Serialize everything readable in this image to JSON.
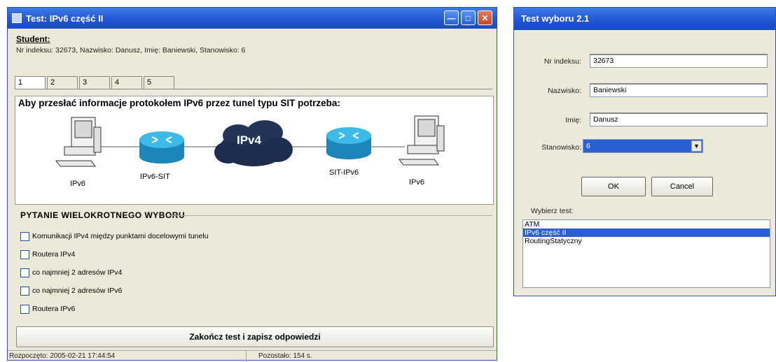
{
  "main_window": {
    "title": "Test: IPv6 część II",
    "student_header": "Student:",
    "student_info": "Nr indeksu: 32673,  Nazwisko: Danusz,  Imię: Baniewski,  Stanowisko: 6",
    "tabs": [
      {
        "label": "1",
        "active": true
      },
      {
        "label": "2",
        "active": false
      },
      {
        "label": "3",
        "active": false
      },
      {
        "label": "4",
        "active": false
      },
      {
        "label": "5",
        "active": false
      }
    ],
    "question": "Aby przesłać informacje protokołem IPv6 przez tunel typu SIT potrzeba:",
    "diagram": {
      "left_pc_label": "IPv6",
      "left_router_label": "IPv6-SIT",
      "cloud_label": "IPv4",
      "right_router_label": "SIT-IPv6",
      "right_pc_label": "IPv6"
    },
    "multiple_choice_title": "PYTANIE WIELOKROTNEGO WYBORU",
    "options": [
      {
        "label": "Komunikacji IPv4 między punktami docelowymi tunelu",
        "checked": false
      },
      {
        "label": "Routera IPv4",
        "checked": false
      },
      {
        "label": "co najmniej 2 adresów IPv4",
        "checked": false
      },
      {
        "label": "co najmniej 2 adresów IPv6",
        "checked": false
      },
      {
        "label": "Routera IPv6",
        "checked": false
      }
    ],
    "finish_button": "Zakończ test i zapisz odpowiedzi",
    "status_started": "Rozpoczęto: 2005-02-21 17:44:54",
    "status_remaining": "Pozostało: 154 s."
  },
  "dialog": {
    "title": "Test wyboru 2.1",
    "fields": {
      "index_label": "Nr indeksu:",
      "index_value": "32673",
      "surname_label": "Nazwisko:",
      "surname_value": "Baniewski",
      "name_label": "Imię:",
      "name_value": "Danusz",
      "station_label": "Stanowisko:",
      "station_value": "6"
    },
    "ok_button": "OK",
    "cancel_button": "Cancel",
    "list_label": "Wybierz test:",
    "tests": [
      {
        "label": "ATM",
        "selected": false
      },
      {
        "label": "IPv6 część II",
        "selected": true
      },
      {
        "label": "RoutingStatyczny",
        "selected": false
      }
    ]
  },
  "colors": {
    "titlebar": "#1f55d0",
    "window_bg": "#ece9d8",
    "selection": "#2a5fd8",
    "router": "#2fa6d6",
    "cloud": "#1e2c4e"
  }
}
